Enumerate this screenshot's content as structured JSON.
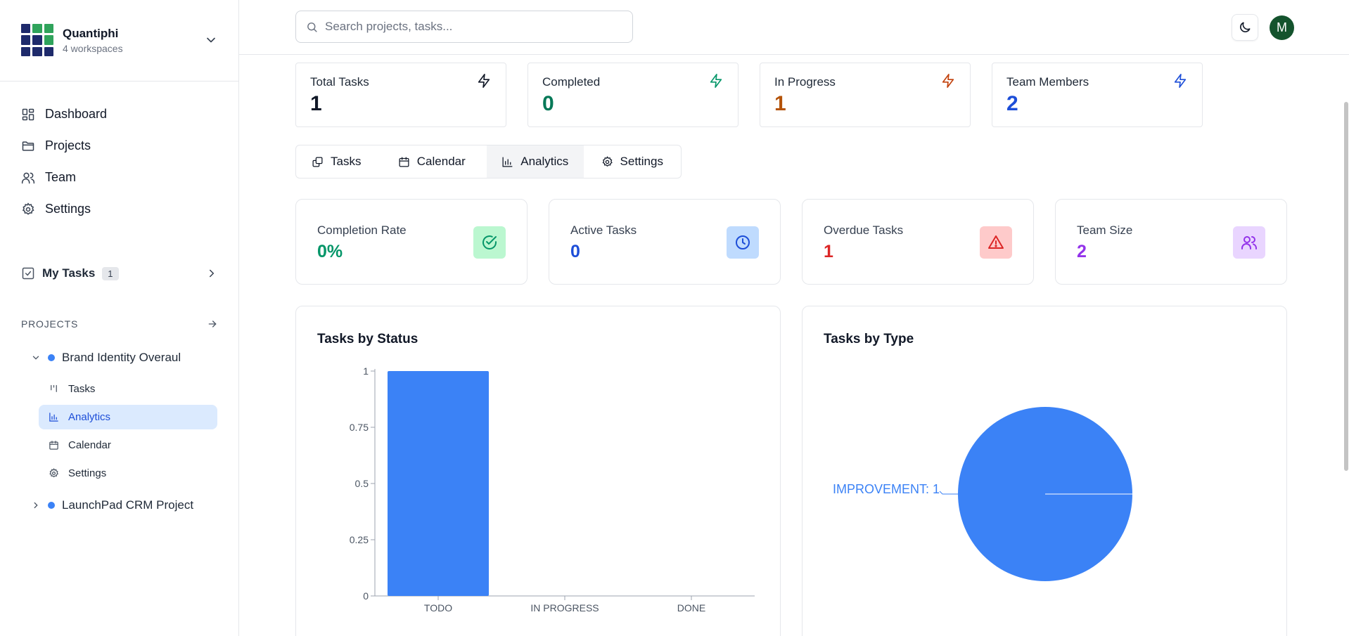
{
  "workspace": {
    "name": "Quantiphi",
    "subtitle": "4 workspaces"
  },
  "nav": [
    {
      "label": "Dashboard",
      "icon": "dashboard-icon"
    },
    {
      "label": "Projects",
      "icon": "folder-icon"
    },
    {
      "label": "Team",
      "icon": "users-icon"
    },
    {
      "label": "Settings",
      "icon": "gear-icon"
    }
  ],
  "my_tasks": {
    "label": "My Tasks",
    "count": "1"
  },
  "projects_section": {
    "heading": "PROJECTS"
  },
  "projects": [
    {
      "name": "Brand Identity Overaul",
      "expanded": true,
      "color": "#3b82f6",
      "subitems": [
        {
          "label": "Tasks",
          "active": false
        },
        {
          "label": "Analytics",
          "active": true
        },
        {
          "label": "Calendar",
          "active": false
        },
        {
          "label": "Settings",
          "active": false
        }
      ]
    },
    {
      "name": "LaunchPad CRM Project",
      "expanded": false,
      "color": "#3b82f6"
    }
  ],
  "header": {
    "search_placeholder": "Search projects, tasks...",
    "avatar_initial": "M"
  },
  "stats": [
    {
      "label": "Total Tasks",
      "value": "1",
      "color": "#111827"
    },
    {
      "label": "Completed",
      "value": "0",
      "color": "#047857"
    },
    {
      "label": "In Progress",
      "value": "1",
      "color": "#b45309"
    },
    {
      "label": "Team Members",
      "value": "2",
      "color": "#1d4ed8"
    }
  ],
  "tabs": [
    {
      "label": "Tasks",
      "active": false
    },
    {
      "label": "Calendar",
      "active": false
    },
    {
      "label": "Analytics",
      "active": true
    },
    {
      "label": "Settings",
      "active": false
    }
  ],
  "metrics": [
    {
      "label": "Completion Rate",
      "value": "0%",
      "color": "#059669",
      "icon_bg": "#bbf7d0"
    },
    {
      "label": "Active Tasks",
      "value": "0",
      "color": "#1d4ed8",
      "icon_bg": "#bfdbfe"
    },
    {
      "label": "Overdue Tasks",
      "value": "1",
      "color": "#dc2626",
      "icon_bg": "#fecaca"
    },
    {
      "label": "Team Size",
      "value": "2",
      "color": "#9333ea",
      "icon_bg": "#e9d5ff"
    }
  ],
  "chart_data": [
    {
      "type": "bar",
      "title": "Tasks by Status",
      "categories": [
        "TODO",
        "IN PROGRESS",
        "DONE"
      ],
      "values": [
        1,
        0,
        0
      ],
      "ylim": [
        0,
        1
      ],
      "yticks": [
        "0",
        "0.25",
        "0.5",
        "0.75",
        "1"
      ],
      "color": "#3b82f6"
    },
    {
      "type": "pie",
      "title": "Tasks by Type",
      "labels": [
        "IMPROVEMENT"
      ],
      "values": [
        1
      ],
      "slice_labels": [
        "IMPROVEMENT: 1"
      ],
      "color": "#3b82f6"
    }
  ]
}
